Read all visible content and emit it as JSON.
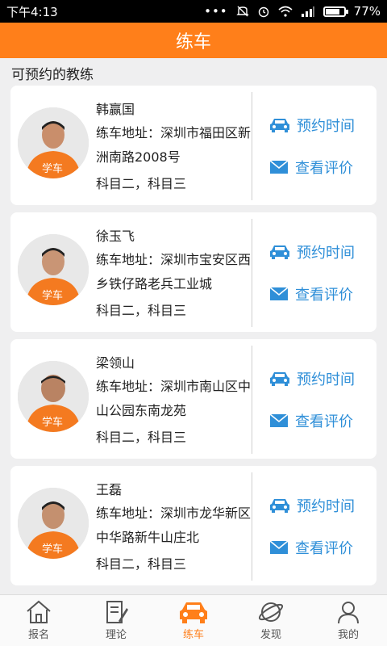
{
  "status_bar": {
    "time": "下午4:13",
    "battery": "77%",
    "battery_level": 0.77
  },
  "header": {
    "title": "练车"
  },
  "section": {
    "title": "可预约的教练"
  },
  "coaches": [
    {
      "name": "韩赢国",
      "address": "练车地址：深圳市福田区新洲南路2008号",
      "subjects": "科目二，科目三"
    },
    {
      "name": "徐玉飞",
      "address": "练车地址：深圳市宝安区西乡铁仔路老兵工业城",
      "subjects": "科目二，科目三"
    },
    {
      "name": "梁领山",
      "address": "练车地址：深圳市南山区中山公园东南龙苑",
      "subjects": "科目二，科目三"
    },
    {
      "name": "王磊",
      "address": "练车地址：深圳市龙华新区中华路新牛山庄北",
      "subjects": "科目二，科目三"
    }
  ],
  "actions": {
    "book_label": "预约时间",
    "review_label": "查看评价"
  },
  "tabs": [
    {
      "label": "报名",
      "icon": "house-icon"
    },
    {
      "label": "理论",
      "icon": "edit-document-icon"
    },
    {
      "label": "练车",
      "icon": "car-icon"
    },
    {
      "label": "发现",
      "icon": "planet-icon"
    },
    {
      "label": "我的",
      "icon": "person-icon"
    }
  ],
  "colors": {
    "accent": "#ff7f1a",
    "link": "#2f8fd8",
    "background": "#efeff0"
  }
}
